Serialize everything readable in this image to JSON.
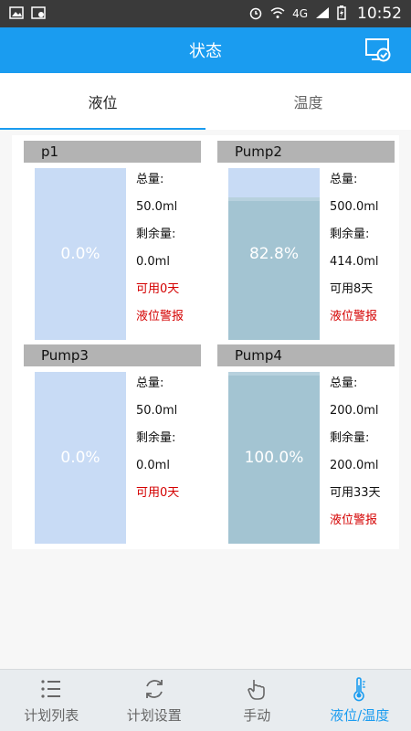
{
  "status_bar": {
    "time": "10:52",
    "network": "4G"
  },
  "appbar": {
    "title": "状态"
  },
  "tabs": [
    {
      "label": "液位",
      "active": true
    },
    {
      "label": "温度",
      "active": false
    }
  ],
  "pumps": [
    {
      "name": "p1",
      "percent_label": "0.0%",
      "fill": 0.0,
      "total_label": "总量:",
      "total": "50.0ml",
      "remaining_label": "剩余量:",
      "remaining": "0.0ml",
      "available": "可用0天",
      "alarm": "液位警报"
    },
    {
      "name": "Pump2",
      "percent_label": "82.8%",
      "fill": 0.828,
      "total_label": "总量:",
      "total": "500.0ml",
      "remaining_label": "剩余量:",
      "remaining": "414.0ml",
      "available": "可用8天",
      "alarm": "液位警报"
    },
    {
      "name": "Pump3",
      "percent_label": "0.0%",
      "fill": 0.0,
      "total_label": "总量:",
      "total": "50.0ml",
      "remaining_label": "剩余量:",
      "remaining": "0.0ml",
      "available": "可用0天",
      "alarm": ""
    },
    {
      "name": "Pump4",
      "percent_label": "100.0%",
      "fill": 1.0,
      "total_label": "总量:",
      "total": "200.0ml",
      "remaining_label": "剩余量:",
      "remaining": "200.0ml",
      "available": "可用33天",
      "alarm": "液位警报"
    }
  ],
  "bottom_nav": [
    {
      "label": "计划列表",
      "icon": "list-icon",
      "active": false
    },
    {
      "label": "计划设置",
      "icon": "refresh-icon",
      "active": false
    },
    {
      "label": "手动",
      "icon": "hand-icon",
      "active": false
    },
    {
      "label": "液位/温度",
      "icon": "thermometer-icon",
      "active": true
    }
  ],
  "colors": {
    "primary": "#1a9cf0",
    "alarm": "#d40000",
    "tank_empty": "#c8dbf5",
    "tank_fill": "#a3c4d2"
  }
}
